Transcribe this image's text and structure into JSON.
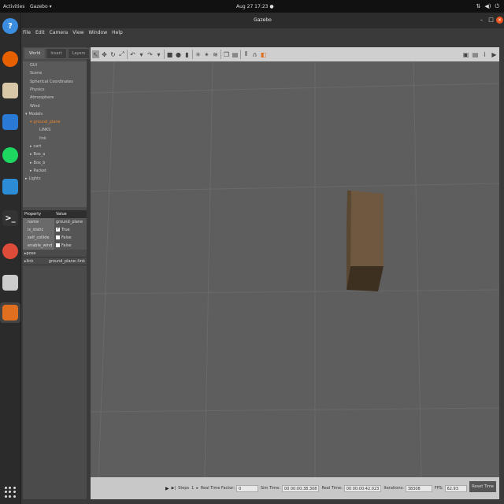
{
  "topbar": {
    "activities": "Activities",
    "app_menu": "Gazebo",
    "app_menu_arrow": "▾",
    "clock": "Aug 27  17:23",
    "clock_dot": "●",
    "tray_icons": [
      "network-icon",
      "volume-icon",
      "power-icon"
    ],
    "tray_glyphs": [
      "⇅",
      "◀)",
      "⏻"
    ]
  },
  "dock": {
    "items": [
      {
        "name": "help-icon",
        "glyph": "?",
        "color": "#3b8de0"
      },
      {
        "name": "firefox-icon",
        "glyph": "",
        "color": "#e66000"
      },
      {
        "name": "files-icon",
        "glyph": "",
        "color": "#d8c8a8"
      },
      {
        "name": "libreoffice-writer-icon",
        "glyph": "",
        "color": "#2a7ad5"
      },
      {
        "name": "spotify-icon",
        "glyph": "",
        "color": "#1ed760"
      },
      {
        "name": "vscode-icon",
        "glyph": "",
        "color": "#2d8cd6"
      },
      {
        "name": "terminal-icon",
        "glyph": ">_",
        "color": "#333333"
      },
      {
        "name": "chrome-icon",
        "glyph": "",
        "color": "#dd4b39"
      },
      {
        "name": "text-editor-icon",
        "glyph": "",
        "color": "#cccccc"
      },
      {
        "name": "gazebo-icon",
        "glyph": "",
        "color": "#e07020"
      }
    ]
  },
  "window": {
    "title": "Gazebo",
    "minimize": "–",
    "maximize": "□",
    "close": "●",
    "menu": [
      "File",
      "Edit",
      "Camera",
      "View",
      "Window",
      "Help"
    ]
  },
  "left_panel": {
    "tabs": [
      "World",
      "Insert",
      "Layers"
    ],
    "tree": [
      {
        "label": "GUI",
        "indent": 0,
        "arrow": ""
      },
      {
        "label": "Scene",
        "indent": 0,
        "arrow": ""
      },
      {
        "label": "Spherical Coordinates",
        "indent": 0,
        "arrow": ""
      },
      {
        "label": "Physics",
        "indent": 0,
        "arrow": ""
      },
      {
        "label": "Atmosphere",
        "indent": 0,
        "arrow": ""
      },
      {
        "label": "Wind",
        "indent": 0,
        "arrow": ""
      },
      {
        "label": "Models",
        "indent": 0,
        "arrow": "▾"
      },
      {
        "label": "ground_plane",
        "indent": 1,
        "arrow": "▾",
        "selected": true
      },
      {
        "label": "LINKS",
        "indent": 2,
        "arrow": ""
      },
      {
        "label": "link",
        "indent": 2,
        "arrow": ""
      },
      {
        "label": "cart",
        "indent": 1,
        "arrow": "▸"
      },
      {
        "label": "Box_a",
        "indent": 1,
        "arrow": "▸"
      },
      {
        "label": "Box_b",
        "indent": 1,
        "arrow": "▸"
      },
      {
        "label": "Packet",
        "indent": 1,
        "arrow": "▸"
      },
      {
        "label": "Lights",
        "indent": 0,
        "arrow": "▸"
      }
    ],
    "properties": {
      "header_property": "Property",
      "header_value": "Value",
      "rows": [
        {
          "key": "name",
          "value": "ground_plane",
          "check": false
        },
        {
          "key": "is_static",
          "value": "True",
          "check": true
        },
        {
          "key": "self_collide",
          "value": "False",
          "check": false
        },
        {
          "key": "enable_wind",
          "value": "False",
          "check": false
        }
      ],
      "sections": [
        {
          "label": "pose",
          "arrow": "▸",
          "value": ""
        },
        {
          "label": "link",
          "arrow": "▸",
          "value": "ground_plane::link"
        }
      ]
    }
  },
  "toolbar": {
    "tools": [
      {
        "name": "select-mode-icon",
        "glyph": "↖",
        "active": true
      },
      {
        "name": "translate-mode-icon",
        "glyph": "✥"
      },
      {
        "name": "rotate-mode-icon",
        "glyph": "↻"
      },
      {
        "name": "scale-mode-icon",
        "glyph": "⤢"
      },
      {
        "name": "undo-icon",
        "glyph": "↶"
      },
      {
        "name": "undo-dropdown-icon",
        "glyph": "▾"
      },
      {
        "name": "redo-icon",
        "glyph": "↷"
      },
      {
        "name": "redo-dropdown-icon",
        "glyph": "▾"
      },
      {
        "name": "box-shape-icon",
        "glyph": "■"
      },
      {
        "name": "sphere-shape-icon",
        "glyph": "●"
      },
      {
        "name": "cylinder-shape-icon",
        "glyph": "▮"
      },
      {
        "name": "point-light-icon",
        "glyph": "✳"
      },
      {
        "name": "spot-light-icon",
        "glyph": "✴"
      },
      {
        "name": "directional-light-icon",
        "glyph": "≋"
      },
      {
        "name": "copy-icon",
        "glyph": "❐"
      },
      {
        "name": "paste-icon",
        "glyph": "▤"
      },
      {
        "name": "align-icon",
        "glyph": "⫴"
      },
      {
        "name": "snap-icon",
        "glyph": "∩"
      },
      {
        "name": "change-view-icon",
        "glyph": "◧"
      }
    ],
    "right_tools": [
      {
        "name": "screenshot-icon",
        "glyph": "▣"
      },
      {
        "name": "log-icon",
        "glyph": "▤"
      },
      {
        "name": "plot-icon",
        "glyph": "⌇"
      },
      {
        "name": "video-record-icon",
        "glyph": "▶"
      }
    ]
  },
  "status": {
    "play": "▶",
    "step_icon": "▶|",
    "steps_label": "Steps",
    "steps_value": "1",
    "steps_arrow": "▸",
    "rtf_label": "Real Time Factor:",
    "rtf_value": "0",
    "sim_label": "Sim Time:",
    "sim_value": "00 00:00:38.308",
    "real_label": "Real Time:",
    "real_value": "00 00:00:42.023",
    "iter_label": "Iterations:",
    "iter_value": "38308",
    "fps_label": "FPS:",
    "fps_value": "62.93",
    "reset_label": "Reset Time"
  }
}
